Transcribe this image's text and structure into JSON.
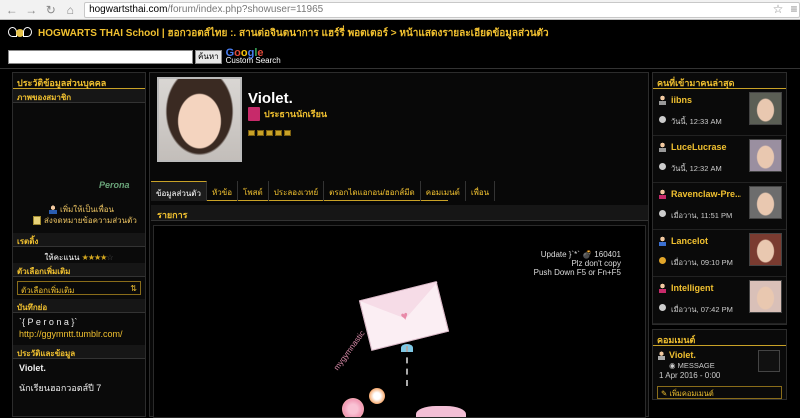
{
  "browser": {
    "url_host": "hogwartsthai.com",
    "url_path": "/forum/index.php?showuser=11965",
    "back_icon": "back-arrow-icon",
    "forward_icon": "forward-arrow-icon",
    "reload_icon": "reload-icon"
  },
  "site": {
    "breadcrumb": "HOGWARTS THAI School | ฮอกวอตส์ไทย :. สานต่อจินตนาการ แฮร์รี่ พอตเตอร์ > หน้าแสดงรายละเอียดข้อมูลส่วนตัว",
    "search_button": "ค้นหา",
    "google_label": "Google",
    "custom_search_label": "Custom Search"
  },
  "left": {
    "header": "ประวัติข้อมูลส่วนบุคคล",
    "photo_label": "ภาพของสมาชิก",
    "signature_text": "Perona",
    "add_friend": "เพิ่มให้เป็นเพื่อน",
    "send_pm": "ส่งจดหมายข้อความส่วนตัว",
    "rating_header": "เรตติ้ง",
    "rating_label": "ให้คะแนน",
    "rating_value": 4,
    "rating_max": 5,
    "options_header": "ตัวเลือกเพิ่มเติม",
    "options_dropdown": "ตัวเลือกเพิ่มเติม",
    "notes_header": "บันทึกย่อ",
    "quote": "`{ P e r o n a }`",
    "link": "http://ggymntt.tumblr.com/",
    "info_header": "ประวัติและข้อมูล",
    "info_name": "Violet.",
    "info_year": "นักเรียนฮอกวอตส์ปี 7"
  },
  "main": {
    "username": "Violet.",
    "rank": "ประธานนักเรียน",
    "tabs": [
      {
        "label": "ข้อมูลส่วนตัว",
        "active": true
      },
      {
        "label": "หัวข้อ",
        "active": false
      },
      {
        "label": "โพสต์",
        "active": false
      },
      {
        "label": "ประลองเวทย์",
        "active": false
      },
      {
        "label": "ตรอกไดแอกอน/ฮอกส์มีด",
        "active": false
      },
      {
        "label": "คอมเมนต์",
        "active": false
      },
      {
        "label": "เพื่อน",
        "active": false
      }
    ],
    "section_header": "รายการ",
    "update_line1": "Update }`*` 💣 160401",
    "update_line2": "Plz don't copy",
    "update_line3": "Push Down F5 or Fn+F5",
    "handwriting": "mygymnastic"
  },
  "right": {
    "visitors_header": "คนที่เข้ามาคนล่าสุด",
    "visitors": [
      {
        "name": "iibns",
        "time": "วันนี้, 12:33 AM",
        "person_color": "#999999",
        "clock": "gray",
        "thumb_color": "#5b5f55"
      },
      {
        "name": "LuceLucrase",
        "time": "วันนี้, 12:32 AM",
        "person_color": "#999999",
        "clock": "gray",
        "thumb_color": "#9a8fa0"
      },
      {
        "name": "Ravenclaw-Pre...",
        "time": "เมื่อวาน, 11:51 PM",
        "person_color": "#c72a6a",
        "clock": "gray",
        "thumb_color": "#6d6d6d"
      },
      {
        "name": "Lancelot",
        "time": "เมื่อวาน, 09:10 PM",
        "person_color": "#3a6fd0",
        "clock": "gold",
        "thumb_color": "#7a3b30"
      },
      {
        "name": "Intelligent",
        "time": "เมื่อวาน, 07:42 PM",
        "person_color": "#c72a6a",
        "clock": "gray",
        "thumb_color": "#d9c0b8"
      }
    ],
    "comments_header": "คอมเมนต์",
    "comment_name": "Violet.",
    "comment_msg": "MESSAGE",
    "comment_date": "1 Apr 2016 - 0:00",
    "add_comment": "เพิ่มคอมเมนต์"
  },
  "colors": {
    "accent": "#f0c030",
    "background": "#000000"
  }
}
